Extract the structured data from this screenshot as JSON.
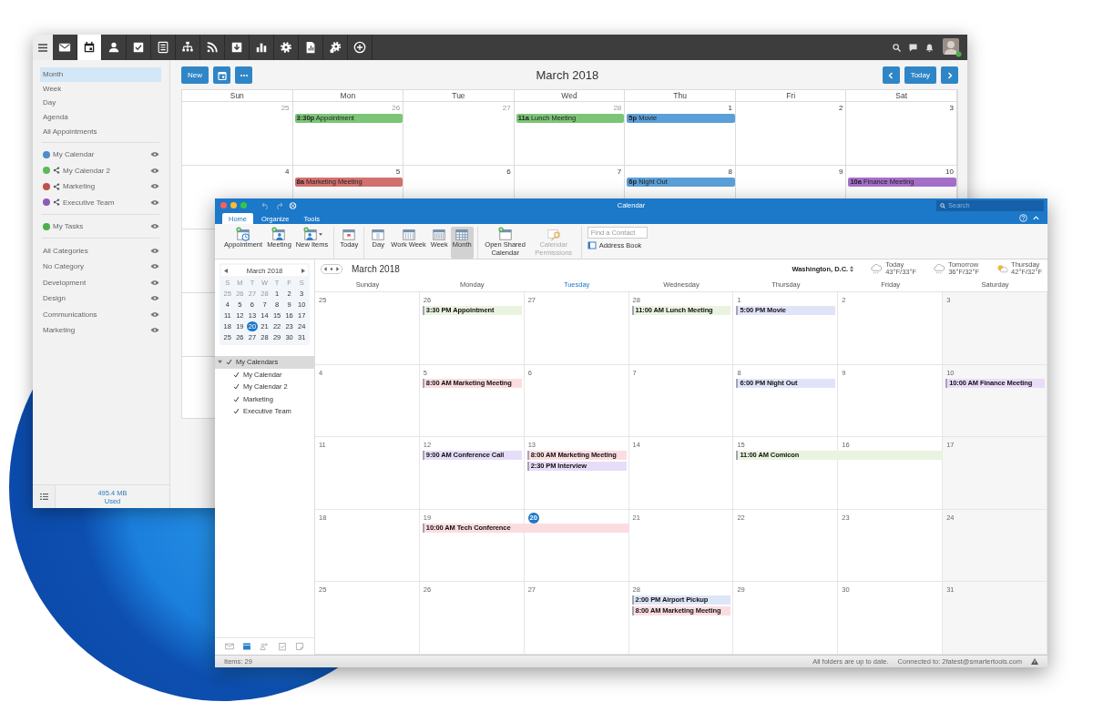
{
  "web_window": {
    "app_tabs": [
      {
        "selected": false
      },
      {
        "selected": true
      },
      {
        "selected": false
      },
      {
        "selected": false
      },
      {
        "selected": false
      },
      {
        "selected": false
      },
      {
        "selected": false
      },
      {
        "selected": false
      },
      {
        "selected": false
      },
      {
        "selected": false
      },
      {
        "selected": false
      },
      {
        "selected": false
      },
      {
        "selected": false
      }
    ],
    "views": [
      {
        "label": "Month",
        "selected": true
      },
      {
        "label": "Week",
        "selected": false
      },
      {
        "label": "Day",
        "selected": false
      },
      {
        "label": "Agenda",
        "selected": false
      },
      {
        "label": "All Appointments",
        "selected": false
      }
    ],
    "calendars": [
      {
        "label": "My Calendar",
        "color": "#4f8ccb",
        "shared": false
      },
      {
        "label": "My Calendar 2",
        "color": "#5cb85c",
        "shared": true
      },
      {
        "label": "Marketing",
        "color": "#c0504d",
        "shared": true
      },
      {
        "label": "Executive Team",
        "color": "#8e5bb5",
        "shared": true
      }
    ],
    "task_lists": [
      {
        "label": "My Tasks",
        "color": "#4cae4c",
        "shared": false
      }
    ],
    "categories": [
      {
        "label": "All Categories"
      },
      {
        "label": "No Category"
      },
      {
        "label": "Development"
      },
      {
        "label": "Design"
      },
      {
        "label": "Communications"
      },
      {
        "label": "Marketing"
      }
    ],
    "storage": {
      "amount": "495.4 MB",
      "label": "Used"
    },
    "new_button": "New",
    "title": "March 2018",
    "today_button": "Today",
    "weekdays": [
      "Sun",
      "Mon",
      "Tue",
      "Wed",
      "Thu",
      "Fri",
      "Sat"
    ],
    "weeks": [
      {
        "days": [
          {
            "number": "25",
            "other_month": true
          },
          {
            "number": "26",
            "other_month": true,
            "events": [
              {
                "label": "**3:30p** Appointment",
                "color": "#7cc576"
              }
            ]
          },
          {
            "number": "27",
            "other_month": true
          },
          {
            "number": "28",
            "other_month": true,
            "events": [
              {
                "label": "**11a** Lunch Meeting",
                "color": "#7cc576"
              }
            ]
          },
          {
            "number": "1",
            "other_month": false,
            "events": [
              {
                "label": "**5p** Movie",
                "color": "#5b9fd8"
              }
            ]
          },
          {
            "number": "2",
            "other_month": false
          },
          {
            "number": "3",
            "other_month": false
          }
        ]
      },
      {
        "days": [
          {
            "number": "4",
            "other_month": false
          },
          {
            "number": "5",
            "other_month": false,
            "events": [
              {
                "label": "**8a** Marketing Meeting",
                "color": "#d4716e"
              }
            ]
          },
          {
            "number": "6",
            "other_month": false
          },
          {
            "number": "7",
            "other_month": false
          },
          {
            "number": "8",
            "other_month": false,
            "events": [
              {
                "label": "**6p** Night Out",
                "color": "#5b9fd8"
              }
            ]
          },
          {
            "number": "9",
            "other_month": false
          },
          {
            "number": "10",
            "other_month": false,
            "events": [
              {
                "label": "**10a** Finance Meeting",
                "color": "#a56fca"
              }
            ]
          }
        ]
      }
    ]
  },
  "outlook_window": {
    "title": "Calendar",
    "search": {
      "placeholder": "Search"
    },
    "tabs": [
      {
        "label": "Home",
        "selected": true
      },
      {
        "label": "Organize",
        "selected": false
      },
      {
        "label": "Tools",
        "selected": false
      }
    ],
    "ribbon_groups": [
      {
        "buttons": [
          {
            "label": "Appointment",
            "selected": false,
            "disabled": false,
            "dropdown": false
          },
          {
            "label": "Meeting",
            "selected": false,
            "disabled": false,
            "dropdown": false
          },
          {
            "label": "New Items",
            "selected": false,
            "disabled": false,
            "dropdown": true
          }
        ]
      },
      {
        "buttons": [
          {
            "label": "Today",
            "selected": false,
            "disabled": false,
            "dropdown": false
          }
        ]
      },
      {
        "buttons": [
          {
            "label": "Day",
            "selected": false,
            "disabled": false,
            "dropdown": false
          },
          {
            "label": "Work Week",
            "selected": false,
            "disabled": false,
            "dropdown": false
          },
          {
            "label": "Week",
            "selected": false,
            "disabled": false,
            "dropdown": false
          },
          {
            "label": "Month",
            "selected": true,
            "disabled": false,
            "dropdown": false
          }
        ]
      },
      {
        "buttons": [
          {
            "label": "Open Shared Calendar",
            "selected": false,
            "disabled": false,
            "dropdown": false
          },
          {
            "label": "Calendar Permissions",
            "selected": false,
            "disabled": true,
            "dropdown": false
          }
        ]
      }
    ],
    "contact_search": {
      "placeholder": "Find a Contact"
    },
    "address_book": "Address Book",
    "mini_calendar": {
      "title": "March 2018",
      "weekdays": [
        "S",
        "M",
        "T",
        "W",
        "T",
        "F",
        "S"
      ],
      "weeks": [
        [
          {
            "number": "25",
            "other_month": true,
            "selected": false
          },
          {
            "number": "26",
            "other_month": true,
            "selected": false
          },
          {
            "number": "27",
            "other_month": true,
            "selected": false
          },
          {
            "number": "28",
            "other_month": true,
            "selected": false
          },
          {
            "number": "1",
            "other_month": false,
            "selected": false
          },
          {
            "number": "2",
            "other_month": false,
            "selected": false
          },
          {
            "number": "3",
            "other_month": false,
            "selected": false
          }
        ],
        [
          {
            "number": "4",
            "other_month": false,
            "selected": false
          },
          {
            "number": "5",
            "other_month": false,
            "selected": false
          },
          {
            "number": "6",
            "other_month": false,
            "selected": false
          },
          {
            "number": "7",
            "other_month": false,
            "selected": false
          },
          {
            "number": "8",
            "other_month": false,
            "selected": false
          },
          {
            "number": "9",
            "other_month": false,
            "selected": false
          },
          {
            "number": "10",
            "other_month": false,
            "selected": false
          }
        ],
        [
          {
            "number": "11",
            "other_month": false,
            "selected": false
          },
          {
            "number": "12",
            "other_month": false,
            "selected": false
          },
          {
            "number": "13",
            "other_month": false,
            "selected": false
          },
          {
            "number": "14",
            "other_month": false,
            "selected": false
          },
          {
            "number": "15",
            "other_month": false,
            "selected": false
          },
          {
            "number": "16",
            "other_month": false,
            "selected": false
          },
          {
            "number": "17",
            "other_month": false,
            "selected": false
          }
        ],
        [
          {
            "number": "18",
            "other_month": false,
            "selected": false
          },
          {
            "number": "19",
            "other_month": false,
            "selected": false
          },
          {
            "number": "20",
            "other_month": false,
            "selected": true
          },
          {
            "number": "21",
            "other_month": false,
            "selected": false
          },
          {
            "number": "22",
            "other_month": false,
            "selected": false
          },
          {
            "number": "23",
            "other_month": false,
            "selected": false
          },
          {
            "number": "24",
            "other_month": false,
            "selected": false
          }
        ],
        [
          {
            "number": "25",
            "other_month": false,
            "selected": false
          },
          {
            "number": "26",
            "other_month": false,
            "selected": false
          },
          {
            "number": "27",
            "other_month": false,
            "selected": false
          },
          {
            "number": "28",
            "other_month": false,
            "selected": false
          },
          {
            "number": "29",
            "other_month": false,
            "selected": false
          },
          {
            "number": "30",
            "other_month": false,
            "selected": false
          },
          {
            "number": "31",
            "other_month": false,
            "selected": false
          }
        ]
      ]
    },
    "calendars": [
      {
        "label": "My Calendars",
        "checked": true,
        "expanded": true,
        "children": [
          {
            "label": "My Calendar",
            "checked": true
          },
          {
            "label": "My Calendar 2",
            "checked": true
          },
          {
            "label": "Marketing",
            "checked": true
          },
          {
            "label": "Executive Team",
            "checked": true
          }
        ]
      }
    ],
    "nav": [
      {
        "selected": false
      },
      {
        "selected": true
      },
      {
        "selected": false
      },
      {
        "selected": false
      },
      {
        "selected": false
      }
    ],
    "month_title": "March 2018",
    "location": "Washington, D.C.",
    "forecast": [
      {
        "day": "Today",
        "temps": "43°F/33°F",
        "kind": "rain"
      },
      {
        "day": "Tomorrow",
        "temps": "36°F/32°F",
        "kind": "rain"
      },
      {
        "day": "Thursday",
        "temps": "42°F/32°F",
        "kind": "partly-sunny"
      }
    ],
    "weekdays": [
      {
        "label": "Sunday",
        "today": false
      },
      {
        "label": "Monday",
        "today": false
      },
      {
        "label": "Tuesday",
        "today": true
      },
      {
        "label": "Wednesday",
        "today": false
      },
      {
        "label": "Thursday",
        "today": false
      },
      {
        "label": "Friday",
        "today": false
      },
      {
        "label": "Saturday",
        "today": false
      }
    ],
    "weeks": [
      {
        "days": [
          {
            "number": "25",
            "today": false
          },
          {
            "number": "26",
            "today": false,
            "events": [
              {
                "label": "3:30 PM Appointment",
                "color": "#e9f3df",
                "continues": false
              }
            ]
          },
          {
            "number": "27",
            "today": false
          },
          {
            "number": "28",
            "today": false,
            "events": [
              {
                "label": "11:00 AM Lunch Meeting",
                "color": "#e9f3df",
                "continues": false
              }
            ]
          },
          {
            "number": "1",
            "today": false,
            "events": [
              {
                "label": "5:00 PM Movie",
                "color": "#e1e4f8",
                "continues": false
              }
            ]
          },
          {
            "number": "2",
            "today": false
          },
          {
            "number": "3",
            "today": false
          }
        ]
      },
      {
        "days": [
          {
            "number": "4",
            "today": false
          },
          {
            "number": "5",
            "today": false,
            "events": [
              {
                "label": "8:00 AM Marketing Meeting",
                "color": "#fbdde0",
                "continues": false
              }
            ]
          },
          {
            "number": "6",
            "today": false
          },
          {
            "number": "7",
            "today": false
          },
          {
            "number": "8",
            "today": false,
            "events": [
              {
                "label": "6:00 PM Night Out",
                "color": "#e1e4f8",
                "continues": false
              }
            ]
          },
          {
            "number": "9",
            "today": false
          },
          {
            "number": "10",
            "today": false,
            "events": [
              {
                "label": "10:00 AM Finance Meeting",
                "color": "#eadcf8",
                "continues": false
              }
            ]
          }
        ]
      },
      {
        "days": [
          {
            "number": "11",
            "today": false
          },
          {
            "number": "12",
            "today": false,
            "events": [
              {
                "label": "9:00 AM Conference Call",
                "color": "#e6ddf8",
                "continues": false
              }
            ]
          },
          {
            "number": "13",
            "today": false,
            "events": [
              {
                "label": "8:00 AM Marketing Meeting",
                "color": "#fbdde0",
                "continues": false
              },
              {
                "label": "2:30 PM Interview",
                "color": "#e6ddf8",
                "continues": false
              }
            ]
          },
          {
            "number": "14",
            "today": false
          },
          {
            "number": "15",
            "today": false,
            "events": [
              {
                "label": "11:00 AM Comicon",
                "color": "#e9f3df",
                "continues": true
              }
            ]
          },
          {
            "number": "16",
            "today": false
          },
          {
            "number": "17",
            "today": false
          }
        ]
      },
      {
        "days": [
          {
            "number": "18",
            "today": false
          },
          {
            "number": "19",
            "today": false,
            "events": [
              {
                "label": "10:00 AM Tech Conference",
                "color": "#fbdde0",
                "continues": true
              }
            ]
          },
          {
            "number": "20",
            "today": true
          },
          {
            "number": "21",
            "today": false
          },
          {
            "number": "22",
            "today": false
          },
          {
            "number": "23",
            "today": false
          },
          {
            "number": "24",
            "today": false
          }
        ]
      },
      {
        "days": [
          {
            "number": "25",
            "today": false
          },
          {
            "number": "26",
            "today": false
          },
          {
            "number": "27",
            "today": false
          },
          {
            "number": "28",
            "today": false,
            "events": [
              {
                "label": "2:00 PM Airport Pickup",
                "color": "#dde6f8",
                "continues": false
              },
              {
                "label": "8:00 AM Marketing Meeting",
                "color": "#fbdde0",
                "continues": false
              }
            ]
          },
          {
            "number": "29",
            "today": false
          },
          {
            "number": "30",
            "today": false
          },
          {
            "number": "31",
            "today": false
          }
        ]
      }
    ],
    "status": {
      "items": "Items: 29",
      "sync": "All folders are up to date.",
      "connection": "Connected to: 2fatest@smartertools.com"
    }
  }
}
